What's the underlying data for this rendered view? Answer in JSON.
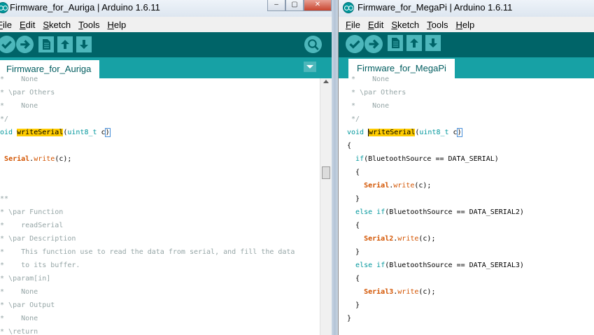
{
  "left_window": {
    "title": "Firmware_for_Auriga | Arduino 1.6.11",
    "menu": [
      "File",
      "Edit",
      "Sketch",
      "Tools",
      "Help"
    ],
    "tab_label": "Firmware_for_Auriga",
    "window_controls": [
      "–",
      "▢",
      "✕"
    ],
    "code": [
      [
        {
          "t": " *    None",
          "c": "cm"
        }
      ],
      [
        {
          "t": " * \\par Others",
          "c": "cm"
        }
      ],
      [
        {
          "t": " *    None",
          "c": "cm"
        }
      ],
      [
        {
          "t": " */",
          "c": "cm"
        }
      ],
      [
        {
          "t": "void ",
          "c": "kw"
        },
        {
          "t": "writeSerial",
          "c": "hl"
        },
        {
          "t": "(",
          "c": ""
        },
        {
          "t": "uint8_t",
          "c": "kw"
        },
        {
          "t": " c",
          "c": ""
        },
        {
          "t": ")",
          "c": "bracket"
        }
      ],
      [
        {
          "t": "{",
          "c": ""
        }
      ],
      [
        {
          "t": "  ",
          "c": ""
        },
        {
          "t": "Serial",
          "c": "fnb"
        },
        {
          "t": ".",
          "c": ""
        },
        {
          "t": "write",
          "c": "fn"
        },
        {
          "t": "(c);",
          "c": ""
        }
      ],
      [
        {
          "t": "}",
          "c": ""
        }
      ],
      [
        {
          "t": "",
          "c": ""
        }
      ],
      [
        {
          "t": "/**",
          "c": "cm"
        }
      ],
      [
        {
          "t": " * \\par Function",
          "c": "cm"
        }
      ],
      [
        {
          "t": " *    readSerial",
          "c": "cm"
        }
      ],
      [
        {
          "t": " * \\par Description",
          "c": "cm"
        }
      ],
      [
        {
          "t": " *    This function use to read the data from serial, and fill the data",
          "c": "cm"
        }
      ],
      [
        {
          "t": " *    to its buffer.",
          "c": "cm"
        }
      ],
      [
        {
          "t": " * \\param[in]",
          "c": "cm"
        }
      ],
      [
        {
          "t": " *    None",
          "c": "cm"
        }
      ],
      [
        {
          "t": " * \\par Output",
          "c": "cm"
        }
      ],
      [
        {
          "t": " *    None",
          "c": "cm"
        }
      ],
      [
        {
          "t": " * \\return",
          "c": "cm"
        }
      ]
    ]
  },
  "right_window": {
    "title": "Firmware_for_MegaPi | Arduino 1.6.11",
    "menu": [
      "File",
      "Edit",
      "Sketch",
      "Tools",
      "Help"
    ],
    "tab_label": "Firmware_for_MegaPi",
    "code": [
      [
        {
          "t": " *    None",
          "c": "cm"
        }
      ],
      [
        {
          "t": " * \\par Others",
          "c": "cm"
        }
      ],
      [
        {
          "t": " *    None",
          "c": "cm"
        }
      ],
      [
        {
          "t": " */",
          "c": "cm"
        }
      ],
      [
        {
          "t": "void ",
          "c": "kw"
        },
        {
          "t": "writeSerial",
          "c": "hl caret"
        },
        {
          "t": "(",
          "c": ""
        },
        {
          "t": "uint8_t",
          "c": "kw"
        },
        {
          "t": " c",
          "c": ""
        },
        {
          "t": ")",
          "c": "bracket"
        }
      ],
      [
        {
          "t": "{",
          "c": ""
        }
      ],
      [
        {
          "t": "  ",
          "c": ""
        },
        {
          "t": "if",
          "c": "kw"
        },
        {
          "t": "(BluetoothSource == DATA_SERIAL)",
          "c": ""
        }
      ],
      [
        {
          "t": "  {",
          "c": ""
        }
      ],
      [
        {
          "t": "    ",
          "c": ""
        },
        {
          "t": "Serial",
          "c": "fnb"
        },
        {
          "t": ".",
          "c": ""
        },
        {
          "t": "write",
          "c": "fn"
        },
        {
          "t": "(c);",
          "c": ""
        }
      ],
      [
        {
          "t": "  }",
          "c": ""
        }
      ],
      [
        {
          "t": "  ",
          "c": ""
        },
        {
          "t": "else",
          "c": "kw"
        },
        {
          "t": " ",
          "c": ""
        },
        {
          "t": "if",
          "c": "kw"
        },
        {
          "t": "(BluetoothSource == DATA_SERIAL2)",
          "c": ""
        }
      ],
      [
        {
          "t": "  {",
          "c": ""
        }
      ],
      [
        {
          "t": "    ",
          "c": ""
        },
        {
          "t": "Serial2",
          "c": "fnb"
        },
        {
          "t": ".",
          "c": ""
        },
        {
          "t": "write",
          "c": "fn"
        },
        {
          "t": "(c);",
          "c": ""
        }
      ],
      [
        {
          "t": "  }",
          "c": ""
        }
      ],
      [
        {
          "t": "  ",
          "c": ""
        },
        {
          "t": "else",
          "c": "kw"
        },
        {
          "t": " ",
          "c": ""
        },
        {
          "t": "if",
          "c": "kw"
        },
        {
          "t": "(BluetoothSource == DATA_SERIAL3)",
          "c": ""
        }
      ],
      [
        {
          "t": "  {",
          "c": ""
        }
      ],
      [
        {
          "t": "    ",
          "c": ""
        },
        {
          "t": "Serial3",
          "c": "fnb"
        },
        {
          "t": ".",
          "c": ""
        },
        {
          "t": "write",
          "c": "fn"
        },
        {
          "t": "(c);",
          "c": ""
        }
      ],
      [
        {
          "t": "  }",
          "c": ""
        }
      ],
      [
        {
          "t": "}",
          "c": ""
        }
      ]
    ]
  },
  "colors": {
    "toolbar_bg": "#006468",
    "tabbar_bg": "#17a1a5",
    "button_bg": "#4db7bb",
    "highlight": "#ffcc00",
    "keyword": "#00979c",
    "function": "#d35400",
    "comment": "#95a5a6"
  },
  "icons": [
    "arduino-logo-icon",
    "verify-icon",
    "upload-icon",
    "new-icon",
    "open-icon",
    "save-icon",
    "serial-monitor-icon",
    "tab-menu-chevron-icon"
  ]
}
